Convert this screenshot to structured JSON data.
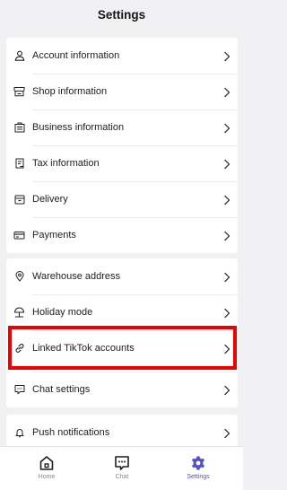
{
  "header": {
    "title": "Settings"
  },
  "groups": [
    {
      "items": [
        {
          "label": "Account information",
          "icon": "user-icon"
        },
        {
          "label": "Shop information",
          "icon": "shop-icon"
        },
        {
          "label": "Business information",
          "icon": "briefcase-icon"
        },
        {
          "label": "Tax information",
          "icon": "tax-document-icon"
        },
        {
          "label": "Delivery",
          "icon": "delivery-box-icon"
        },
        {
          "label": "Payments",
          "icon": "card-icon"
        }
      ]
    },
    {
      "items": [
        {
          "label": "Warehouse address",
          "icon": "location-pin-icon"
        },
        {
          "label": "Holiday mode",
          "icon": "beach-umbrella-icon"
        },
        {
          "label": "Linked TikTok accounts",
          "icon": "link-icon"
        },
        {
          "label": "Chat settings",
          "icon": "chat-bubble-icon"
        }
      ]
    },
    {
      "items": [
        {
          "label": "Push notifications",
          "icon": "bell-icon"
        }
      ]
    }
  ],
  "tabbar": {
    "tabs": [
      {
        "label": "Home",
        "icon": "home-icon",
        "active": false
      },
      {
        "label": "Chat",
        "icon": "chat-icon",
        "active": false
      },
      {
        "label": "Settings",
        "icon": "settings-gear-icon",
        "active": true
      }
    ]
  },
  "colors": {
    "background": "#f1f1f3",
    "card": "#ffffff",
    "highlight": "#ec0000",
    "active_tab": "#5151cc",
    "inactive_tab": "#8a8a8a"
  }
}
